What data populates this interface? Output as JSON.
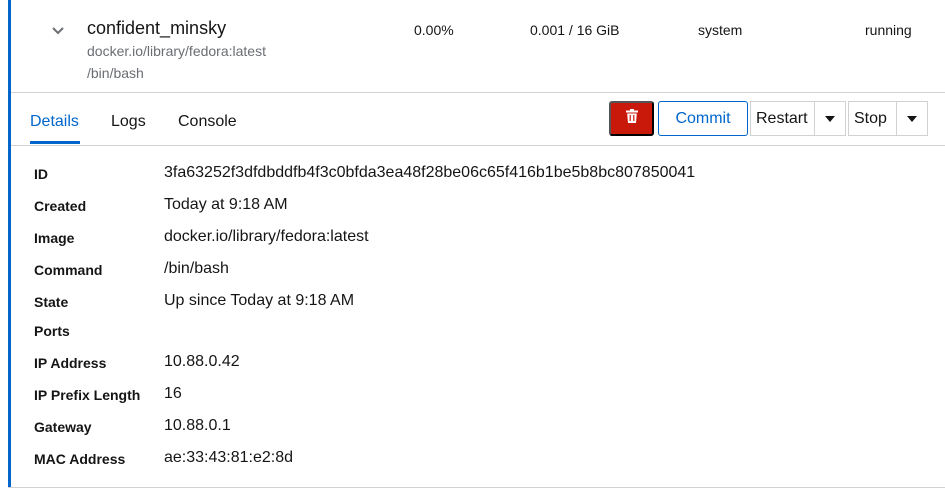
{
  "container": {
    "name": "confident_minsky",
    "image": "docker.io/library/fedora:latest",
    "command": "/bin/bash",
    "cpu": "0.00%",
    "memory": "0.001 / 16 GiB",
    "owner": "system",
    "state": "running"
  },
  "tabs": [
    "Details",
    "Logs",
    "Console"
  ],
  "actions": {
    "delete_icon": "trash-icon",
    "commit": "Commit",
    "restart": "Restart",
    "stop": "Stop"
  },
  "details": [
    {
      "label": "ID",
      "value": "3fa63252f3dfdbddfb4f3c0bfda3ea48f28be06c65f416b1be5b8bc807850041"
    },
    {
      "label": "Created",
      "value": "Today at 9:18 AM"
    },
    {
      "label": "Image",
      "value": "docker.io/library/fedora:latest"
    },
    {
      "label": "Command",
      "value": "/bin/bash"
    },
    {
      "label": "State",
      "value": "Up since Today at 9:18 AM"
    },
    {
      "label": "Ports",
      "value": ""
    },
    {
      "label": "IP Address",
      "value": "10.88.0.42"
    },
    {
      "label": "IP Prefix Length",
      "value": "16"
    },
    {
      "label": "Gateway",
      "value": "10.88.0.1"
    },
    {
      "label": "MAC Address",
      "value": "ae:33:43:81:e2:8d"
    }
  ],
  "colors": {
    "accent": "#0066cc",
    "danger": "#c9190b",
    "border": "#d2d2d2",
    "muted_text": "#6a6e73"
  }
}
